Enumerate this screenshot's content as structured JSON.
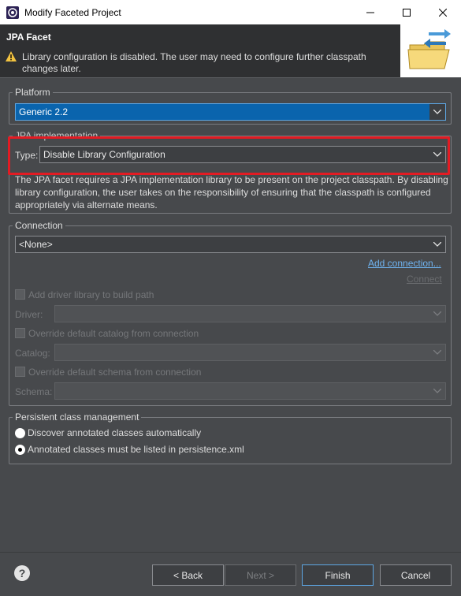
{
  "window": {
    "title": "Modify Faceted Project"
  },
  "banner": {
    "heading": "JPA Facet",
    "message": "Library configuration is disabled. The user may need to configure further classpath changes later.",
    "warning_icon": "warning-triangle-icon",
    "logo_icon": "open-folder-arrows-icon"
  },
  "platform": {
    "label": "Platform",
    "value": "Generic 2.2"
  },
  "jpa_impl": {
    "label": "JPA implementation",
    "type_label": "Type:",
    "type_value": "Disable Library Configuration",
    "description": "The JPA facet requires a JPA implementation library to be present on the project classpath. By disabling library configuration, the user takes on the responsibility of ensuring that the classpath is configured appropriately via alternate means."
  },
  "connection": {
    "label": "Connection",
    "value": "<None>",
    "add_link": "Add connection...",
    "connect_link": "Connect",
    "add_driver_label": "Add driver library to build path",
    "driver_label": "Driver:",
    "override_catalog_label": "Override default catalog from connection",
    "catalog_label": "Catalog:",
    "override_schema_label": "Override default schema from connection",
    "schema_label": "Schema:"
  },
  "persistent": {
    "label": "Persistent class management",
    "option1": "Discover annotated classes automatically",
    "option2": "Annotated classes must be listed in persistence.xml",
    "selected": 2
  },
  "buttons": {
    "help": "?",
    "back": "< Back",
    "next": "Next >",
    "finish": "Finish",
    "cancel": "Cancel"
  },
  "colors": {
    "background": "#47494c",
    "banner": "#2f3032",
    "selection": "#0a64ad",
    "highlight": "#e31b23",
    "link": "#6fb3f0"
  }
}
